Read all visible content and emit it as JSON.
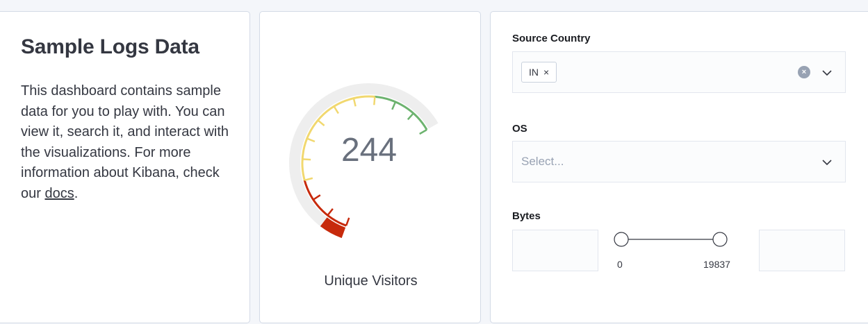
{
  "markdown": {
    "title": "Sample Logs Data",
    "body": "This dashboard contains sample data for you to play with. You can view it, search it, and interact with the visualizations. For more information about Kibana, check our ",
    "link_text": "docs",
    "tail": "."
  },
  "gauge": {
    "value": "244",
    "label": "Unique Visitors",
    "fill_fraction": 0.08,
    "colors": {
      "red": "#c72a0c",
      "yellow": "#f1d86f",
      "green": "#6db36f",
      "track": "#eeeeee"
    }
  },
  "controls": {
    "source_country": {
      "label": "Source Country",
      "selected": [
        "IN"
      ],
      "remove_symbol": "×",
      "clear_symbol": "×"
    },
    "os": {
      "label": "OS",
      "placeholder": "Select..."
    },
    "bytes": {
      "label": "Bytes",
      "min": "0",
      "max": "19837",
      "lower_value": "",
      "upper_value": ""
    }
  }
}
